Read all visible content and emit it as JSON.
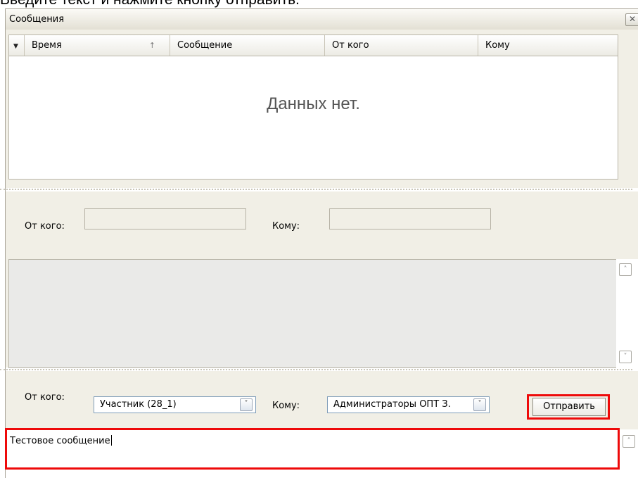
{
  "caption": "Введите текст и нажмите кнопку отправить.",
  "window": {
    "title": "Сообщения",
    "close_glyph": "✕"
  },
  "grid": {
    "columns": [
      {
        "label": "Время",
        "sort": "ascending"
      },
      {
        "label": "Сообщение"
      },
      {
        "label": "От кого"
      },
      {
        "label": "Кому"
      }
    ],
    "empty_text": "Данных нет."
  },
  "view": {
    "from_label": "От кого:",
    "to_label": "Кому:",
    "from_value": "",
    "to_value": ""
  },
  "compose": {
    "from_label": "От кого:",
    "from_value": "Участник (28_1)",
    "to_label": "Кому:",
    "to_value": "Администраторы ОПТ З.",
    "send_label": "Отправить",
    "message_value": "Тестовое сообщение"
  },
  "icons": {
    "sort": "arrow-up-icon",
    "dropdown": "chevron-down-icon",
    "scroll_up": "chevron-up-icon",
    "scroll_down": "chevron-down-icon"
  },
  "colors": {
    "highlight": "#ee0a0a",
    "panel": "#f1efe6",
    "border": "#b9b5a8"
  }
}
